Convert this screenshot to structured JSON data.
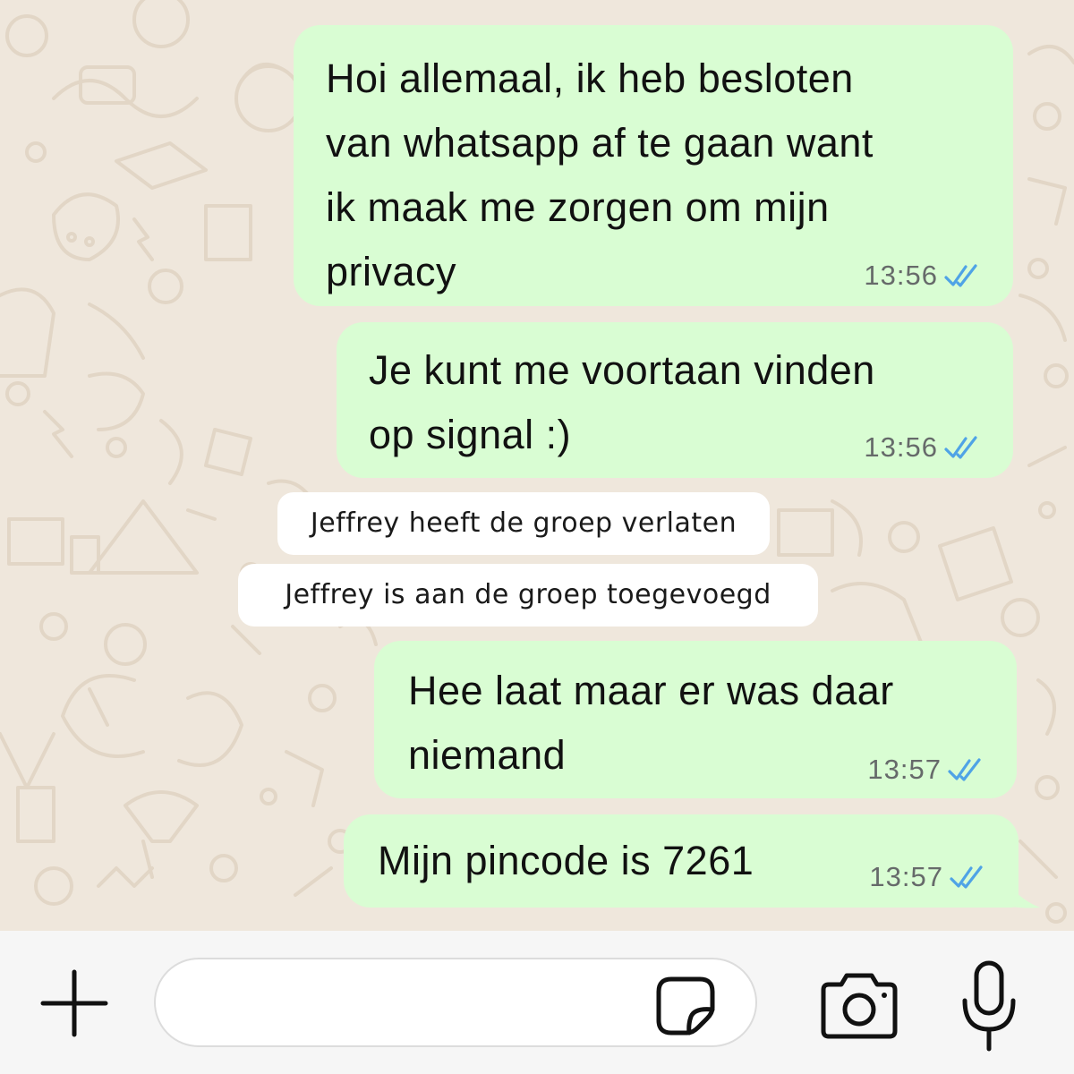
{
  "conversation": {
    "messages": [
      {
        "lines": [
          "Hoi allemaal, ik heb besloten",
          "van whatsapp af te gaan want",
          "ik maak me zorgen om mijn",
          "privacy"
        ],
        "time": "13:56",
        "status_icon": "double-check-read-icon"
      },
      {
        "lines": [
          "Je kunt me voortaan vinden",
          "op signal :)"
        ],
        "time": "13:56",
        "status_icon": "double-check-read-icon"
      },
      {
        "lines": [
          "Hee laat maar er was daar",
          "niemand"
        ],
        "time": "13:57",
        "status_icon": "double-check-read-icon"
      },
      {
        "lines": [
          "Mijn pincode is 7261"
        ],
        "time": "13:57",
        "status_icon": "double-check-read-icon"
      }
    ],
    "system_notices": [
      {
        "text": "Jeffrey heeft de groep verlaten"
      },
      {
        "text": "Jeffrey is aan de groep toegevoegd"
      }
    ]
  },
  "composer": {
    "message_value": "",
    "icons": {
      "attach": "plus-icon",
      "sticker": "sticker-icon",
      "camera": "camera-icon",
      "microphone": "microphone-icon"
    }
  },
  "colors": {
    "outgoing_bubble": "#d9fdd3",
    "read_ticks": "#4fa3e6",
    "system_notice": "#ffffff",
    "chat_background": "#efe7dc",
    "timestamp": "#666a6a"
  }
}
